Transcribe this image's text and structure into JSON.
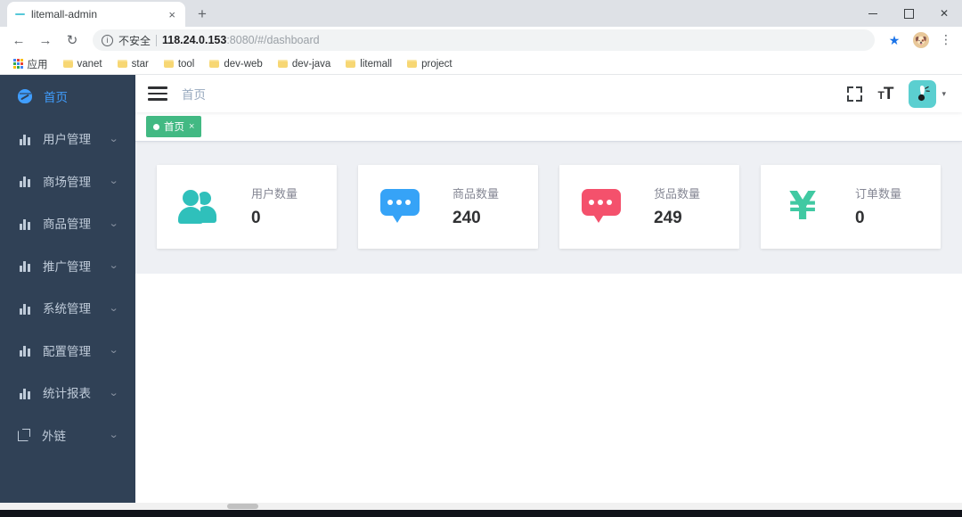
{
  "browser": {
    "tab": {
      "title": "litemall-admin",
      "favicon": "dash-favicon",
      "close_label": "×"
    },
    "new_tab_label": "+",
    "window_controls": {
      "minimize": "—",
      "maximize": "□",
      "close": "✕"
    },
    "nav": {
      "back": "←",
      "forward": "→",
      "reload": "↻"
    },
    "omnibox": {
      "info_icon": "ⓘ",
      "security_label": "不安全",
      "url_host": "118.24.0.153",
      "url_rest": ":8080/#/dashboard",
      "star_icon": "★",
      "profile_icon": "🐶",
      "menu_icon": "⋮"
    },
    "bookmarks": {
      "apps_label": "应用",
      "items": [
        {
          "label": "vanet"
        },
        {
          "label": "star"
        },
        {
          "label": "tool"
        },
        {
          "label": "dev-web"
        },
        {
          "label": "dev-java"
        },
        {
          "label": "litemall"
        },
        {
          "label": "project"
        }
      ]
    }
  },
  "sidebar": {
    "items": [
      {
        "label": "首页",
        "icon": "dashboard-icon",
        "active": true,
        "expandable": false
      },
      {
        "label": "用户管理",
        "icon": "chart-icon",
        "active": false,
        "expandable": true
      },
      {
        "label": "商场管理",
        "icon": "chart-icon",
        "active": false,
        "expandable": true
      },
      {
        "label": "商品管理",
        "icon": "chart-icon",
        "active": false,
        "expandable": true
      },
      {
        "label": "推广管理",
        "icon": "chart-icon",
        "active": false,
        "expandable": true
      },
      {
        "label": "系统管理",
        "icon": "chart-icon",
        "active": false,
        "expandable": true
      },
      {
        "label": "配置管理",
        "icon": "chart-icon",
        "active": false,
        "expandable": true
      },
      {
        "label": "统计报表",
        "icon": "chart-icon",
        "active": false,
        "expandable": true
      },
      {
        "label": "外链",
        "icon": "external-link-icon",
        "active": false,
        "expandable": true
      }
    ],
    "arrow_glyph": "⌄"
  },
  "navbar": {
    "hamburger_label": "menu",
    "breadcrumb": "首页",
    "fullscreen_label": "screenfull",
    "fontsize_label_big": "T",
    "fontsize_label_small": "T",
    "avatar_caret": "▾"
  },
  "tags_view": {
    "tags": [
      {
        "label": "首页",
        "active": true,
        "close_glyph": "×"
      }
    ]
  },
  "cards": [
    {
      "label": "用户数量",
      "value": "0",
      "icon": "people-icon",
      "color": "#2fc0bb"
    },
    {
      "label": "商品数量",
      "value": "240",
      "icon": "message-icon",
      "color": "#36a3f7"
    },
    {
      "label": "货品数量",
      "value": "249",
      "icon": "message-icon",
      "color": "#f4516c"
    },
    {
      "label": "订单数量",
      "value": "0",
      "icon": "yen-icon",
      "color": "#40c9a2"
    }
  ],
  "theme": {
    "sidebar_bg": "#304156",
    "active_blue": "#409eff",
    "tag_green": "#42b983",
    "content_bg": "#eef0f4",
    "avatar_bg": "#5bcfd0"
  },
  "taskbar": {
    "clock": ""
  }
}
